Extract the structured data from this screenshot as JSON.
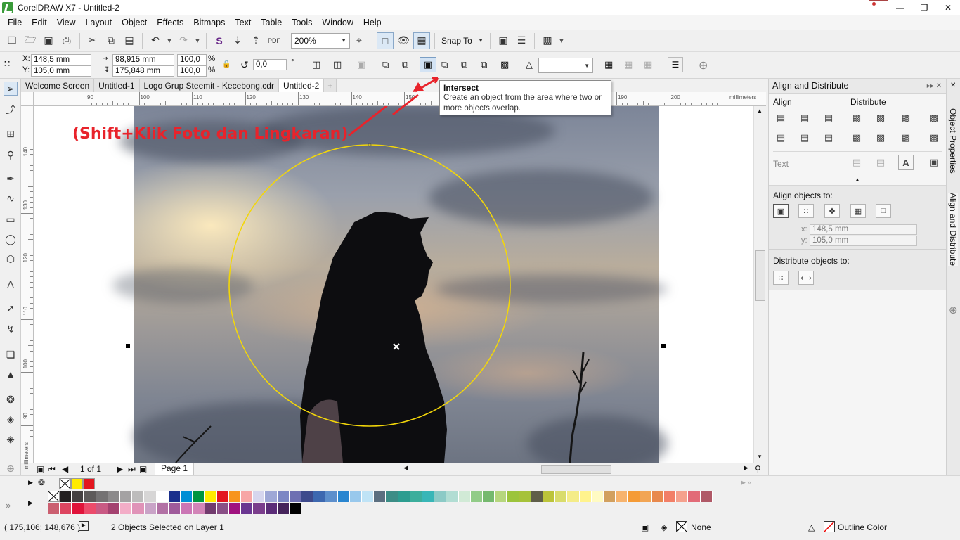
{
  "window": {
    "title": "CorelDRAW X7 - Untitled-2"
  },
  "menu": [
    "File",
    "Edit",
    "View",
    "Layout",
    "Object",
    "Effects",
    "Bitmaps",
    "Text",
    "Table",
    "Tools",
    "Window",
    "Help"
  ],
  "toolbar": {
    "zoom": "200%",
    "snap_to": "Snap To"
  },
  "propbar": {
    "x_label": "X:",
    "x": "148,5 mm",
    "y_label": "Y:",
    "y": "105,0 mm",
    "width": "98,915 mm",
    "height": "175,848 mm",
    "scale_w": "100,0",
    "scale_h": "100,0",
    "pct": "%",
    "rotation": "0,0",
    "deg": "°"
  },
  "doc_tabs": [
    "Welcome Screen",
    "Untitled-1",
    "Logo Grup Steemit - Kecebong.cdr",
    "Untitled-2"
  ],
  "active_tab": "Untitled-2",
  "ruler": {
    "h_numbers": [
      "90",
      "100",
      "110",
      "120",
      "130",
      "140",
      "150",
      "160",
      "170",
      "180",
      "190",
      "200"
    ],
    "h_unit": "millimeters",
    "v_numbers": [
      "140",
      "130",
      "120",
      "110",
      "100",
      "90"
    ],
    "v_unit": "millimeters"
  },
  "canvas": {
    "annotation": "(Shift+Klik Foto dan Lingkaran)",
    "annotation_color": "#e8232b",
    "circle_color": "#f2d60a"
  },
  "tooltip": {
    "title": "Intersect",
    "body": "Create an object from the area where two or more objects overlap."
  },
  "page_nav": {
    "page_count": "1 of 1",
    "page_tab": "Page 1"
  },
  "docker": {
    "title": "Align and Distribute",
    "align": "Align",
    "distribute": "Distribute",
    "text": "Text",
    "align_to": "Align objects to:",
    "x_value": "148,5 mm",
    "y_value": "105,0 mm",
    "x_label": "x:",
    "y_label": "y:",
    "distribute_to": "Distribute objects to:"
  },
  "side_tabs": [
    "Object Properties",
    "Align and Distribute"
  ],
  "status": {
    "coords": "( 175,106; 148,676 )",
    "selection": "2 Objects Selected on Layer 1",
    "fill": "None",
    "outline": "Outline Color"
  },
  "recent_colors": [
    "none",
    "#ffeb00",
    "#e3161f"
  ],
  "palette_row1": [
    "#231f20",
    "#454142",
    "#5d5a5a",
    "#747273",
    "#8c8a8b",
    "#a4a2a3",
    "#bdbcbc",
    "#d7d6d6",
    "#ffffff",
    "#1a2f8c",
    "#008fd5",
    "#009540",
    "#ffeb00",
    "#e3161f",
    "#f7941d",
    "#f7a6a6",
    "#d6d6ee",
    "#9ea7d6",
    "#7c87c4",
    "#6e6fb2",
    "#3e4a8c",
    "#3d68b0",
    "#5d8fcc",
    "#2a86d0",
    "#98c8ec",
    "#bfe3f6",
    "#5c6f80",
    "#3c8d86",
    "#2c9d90",
    "#3cae9c",
    "#38b6b7",
    "#8ccac6",
    "#b1ddd3",
    "#d1ead6",
    "#92cc88",
    "#75b96e",
    "#b6d67d",
    "#9cc43c",
    "#a6c23a",
    "#5f5e49",
    "#bcc43a",
    "#d9dc6b",
    "#f4ec88",
    "#fff38d",
    "#fffbc3",
    "#d2a05f",
    "#f7b36d",
    "#f59b36",
    "#f2a554",
    "#e8894d",
    "#f27f67",
    "#f5a18d",
    "#e26b78",
    "#b05967"
  ],
  "palette_row2": [
    "#cb5f70",
    "#dd4560",
    "#e0133a",
    "#ec4b6b",
    "#c95a84",
    "#a44270",
    "#f3adc7",
    "#e093b8",
    "#c9a3c7",
    "#b271a5",
    "#9f5b9b",
    "#cb76b5",
    "#d285b8",
    "#713b6e",
    "#894f86",
    "#a0127f",
    "#6a3691",
    "#7a3d8c",
    "#5b2c78",
    "#45235a",
    "#000000"
  ]
}
